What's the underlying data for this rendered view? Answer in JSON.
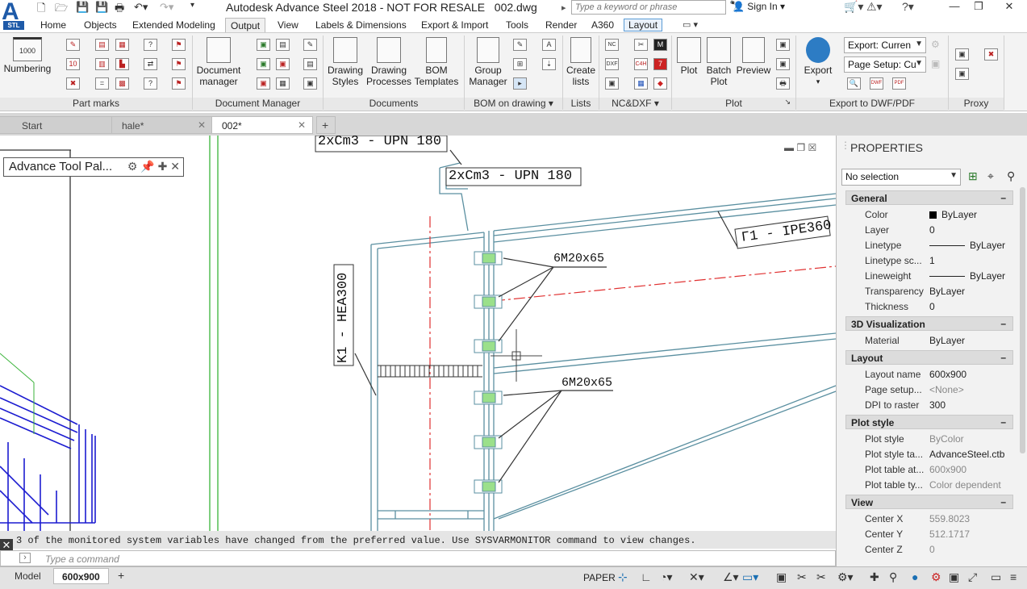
{
  "window": {
    "title": "Autodesk Advance Steel 2018 - NOT FOR RESALE",
    "filename": "002.dwg",
    "app_badge": "STL",
    "search_placeholder": "Type a keyword or phrase",
    "sign_in": "Sign In"
  },
  "ribbon_tabs": [
    "Home",
    "Objects",
    "Extended Modeling",
    "Output",
    "View",
    "Labels & Dimensions",
    "Export & Import",
    "Tools",
    "Render",
    "A360",
    "Layout"
  ],
  "active_tab": "Output",
  "ribbon": {
    "numbering_label": "Numbering",
    "numbering_icon_text": "1000",
    "panels": {
      "part_marks": "Part marks",
      "document_manager": "Document Manager",
      "documents": "Documents",
      "bom_on_drawing": "BOM on drawing",
      "lists": "Lists",
      "nc_dxf": "NC&DXF",
      "plot": "Plot",
      "export": "Export to DWF/PDF",
      "proxy": "Proxy"
    },
    "buttons": {
      "document_manager": "Document manager",
      "drawing_styles": "Drawing Styles",
      "drawing_processes": "Drawing Processes",
      "bom_templates": "BOM Templates",
      "group_manager": "Group Manager",
      "create_lists": "Create lists",
      "plot": "Plot",
      "batch_plot": "Batch Plot",
      "preview": "Preview",
      "export": "Export"
    },
    "export_combo": "Export: Curren",
    "page_setup_combo": "Page Setup: Cu"
  },
  "doc_tabs": [
    "Start",
    "hale*",
    "002*"
  ],
  "active_doc": "002*",
  "tool_palette": "Advance Tool Pal...",
  "drawing": {
    "labels": {
      "upn_top": "2xCm3 - UPN 180",
      "upn_second": "2xCm3 - UPN 180",
      "ipe": "Γ1 - IPE360",
      "hea": "K1 - HEA300",
      "bolts_top": "6M20x65",
      "bolts_bottom": "6M20x65"
    },
    "colors": {
      "steel": "#5a8fa0",
      "axis": "#e03030",
      "bolt": "#3aaa3a",
      "iso": "#1c1cd0"
    }
  },
  "properties": {
    "title": "PROPERTIES",
    "selection": "No selection",
    "sections": [
      {
        "name": "General",
        "rows": [
          {
            "key": "Color",
            "value": "ByLayer",
            "swatch": "#000000"
          },
          {
            "key": "Layer",
            "value": "0"
          },
          {
            "key": "Linetype",
            "value": "ByLayer",
            "line": true
          },
          {
            "key": "Linetype sc...",
            "value": "1"
          },
          {
            "key": "Lineweight",
            "value": "ByLayer",
            "line": true
          },
          {
            "key": "Transparency",
            "value": "ByLayer"
          },
          {
            "key": "Thickness",
            "value": "0"
          }
        ]
      },
      {
        "name": "3D Visualization",
        "rows": [
          {
            "key": "Material",
            "value": "ByLayer"
          }
        ]
      },
      {
        "name": "Layout",
        "rows": [
          {
            "key": "Layout name",
            "value": "600x900"
          },
          {
            "key": "Page setup...",
            "value": "<None>",
            "disabled": true
          },
          {
            "key": "DPI to raster",
            "value": "300"
          }
        ]
      },
      {
        "name": "Plot style",
        "rows": [
          {
            "key": "Plot style",
            "value": "ByColor",
            "disabled": true
          },
          {
            "key": "Plot style ta...",
            "value": "AdvanceSteel.ctb"
          },
          {
            "key": "Plot table at...",
            "value": "600x900",
            "disabled": true
          },
          {
            "key": "Plot table ty...",
            "value": "Color dependent",
            "disabled": true
          }
        ]
      },
      {
        "name": "View",
        "rows": [
          {
            "key": "Center X",
            "value": "559.8023",
            "disabled": true
          },
          {
            "key": "Center Y",
            "value": "512.1717",
            "disabled": true
          },
          {
            "key": "Center Z",
            "value": "0",
            "disabled": true
          }
        ]
      }
    ]
  },
  "command": {
    "message": "3 of the monitored system variables have changed from the preferred value. Use SYSVARMONITOR command to view changes.",
    "placeholder": "Type a command"
  },
  "status": {
    "layout_tabs": [
      "Model",
      "600x900"
    ],
    "active_layout": "600x900",
    "space": "PAPER"
  }
}
